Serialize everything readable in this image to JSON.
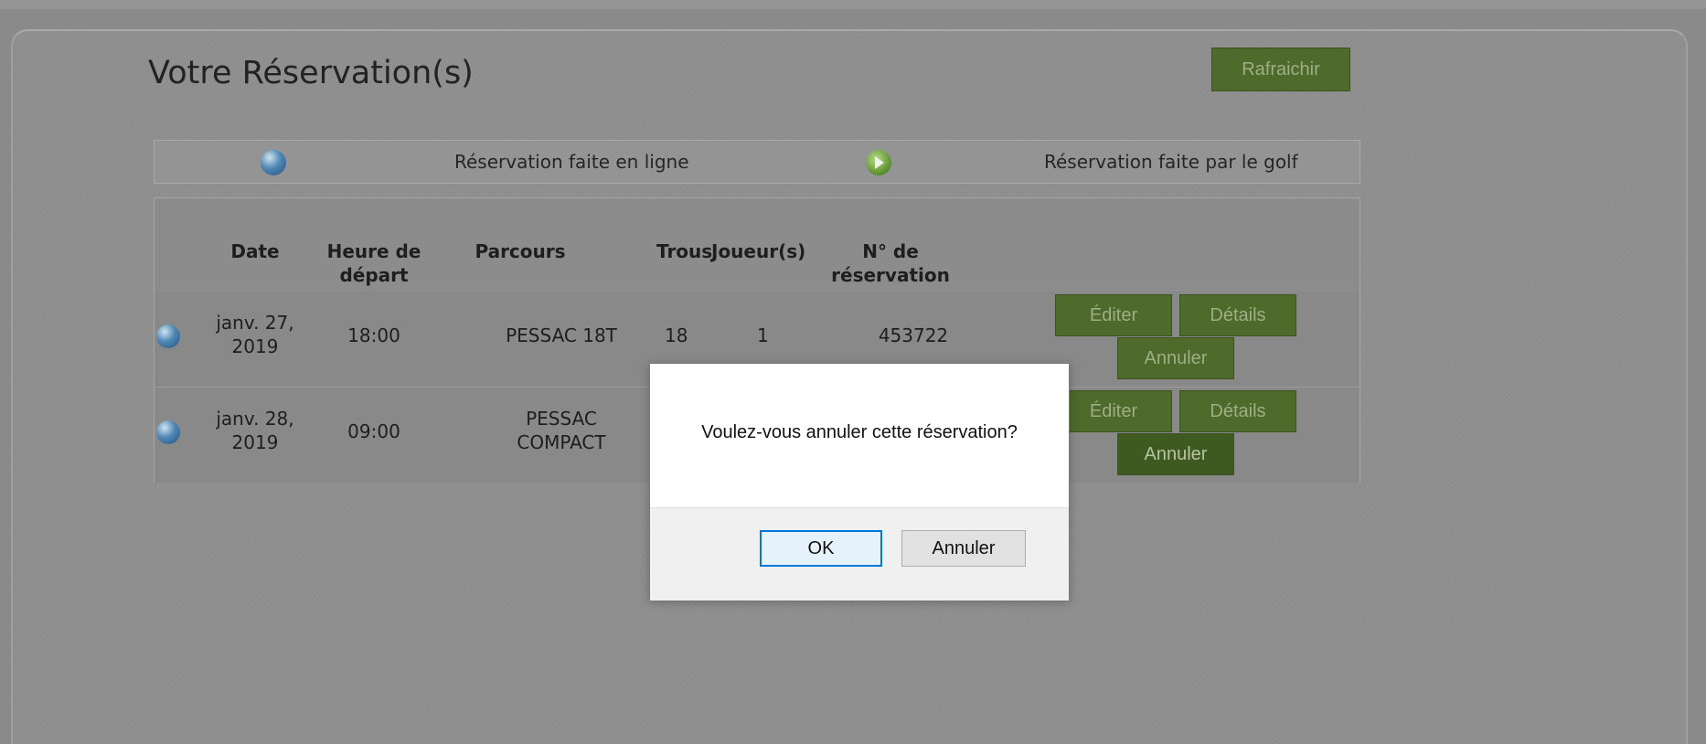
{
  "page": {
    "title": "Votre Réservation(s)",
    "refresh_label": "Rafraichir"
  },
  "legend": {
    "online_label": "Réservation faite en ligne",
    "golf_label": "Réservation faite par le golf",
    "online_icon": "globe-icon",
    "golf_icon": "play-circle-icon"
  },
  "table": {
    "headers": {
      "date": "Date",
      "heure_1": "Heure de",
      "heure_2": "départ",
      "parcours": "Parcours",
      "trous": "Trous",
      "joueurs": "Joueur(s)",
      "num_1": "N° de",
      "num_2": "réservation"
    },
    "rows": [
      {
        "date_1": "janv. 27,",
        "date_2": "2019",
        "heure": "18:00",
        "parcours_1": "PESSAC 18T",
        "parcours_2": "",
        "trous": "18",
        "joueurs": "1",
        "numero": "453722",
        "edit_label": "Éditer",
        "details_label": "Détails",
        "cancel_label": "Annuler"
      },
      {
        "date_1": "janv. 28,",
        "date_2": "2019",
        "heure": "09:00",
        "parcours_1": "PESSAC",
        "parcours_2": "COMPACT",
        "trous": "",
        "joueurs": "",
        "numero": "",
        "edit_label": "Éditer",
        "details_label": "Détails",
        "cancel_label": "Annuler"
      }
    ]
  },
  "dialog": {
    "message": "Voulez-vous annuler cette réservation?",
    "ok_label": "OK",
    "cancel_label": "Annuler"
  },
  "colors": {
    "button_green": "#4f6b2c",
    "background": "#8a8a8a",
    "dialog_focus": "#0078d7"
  }
}
